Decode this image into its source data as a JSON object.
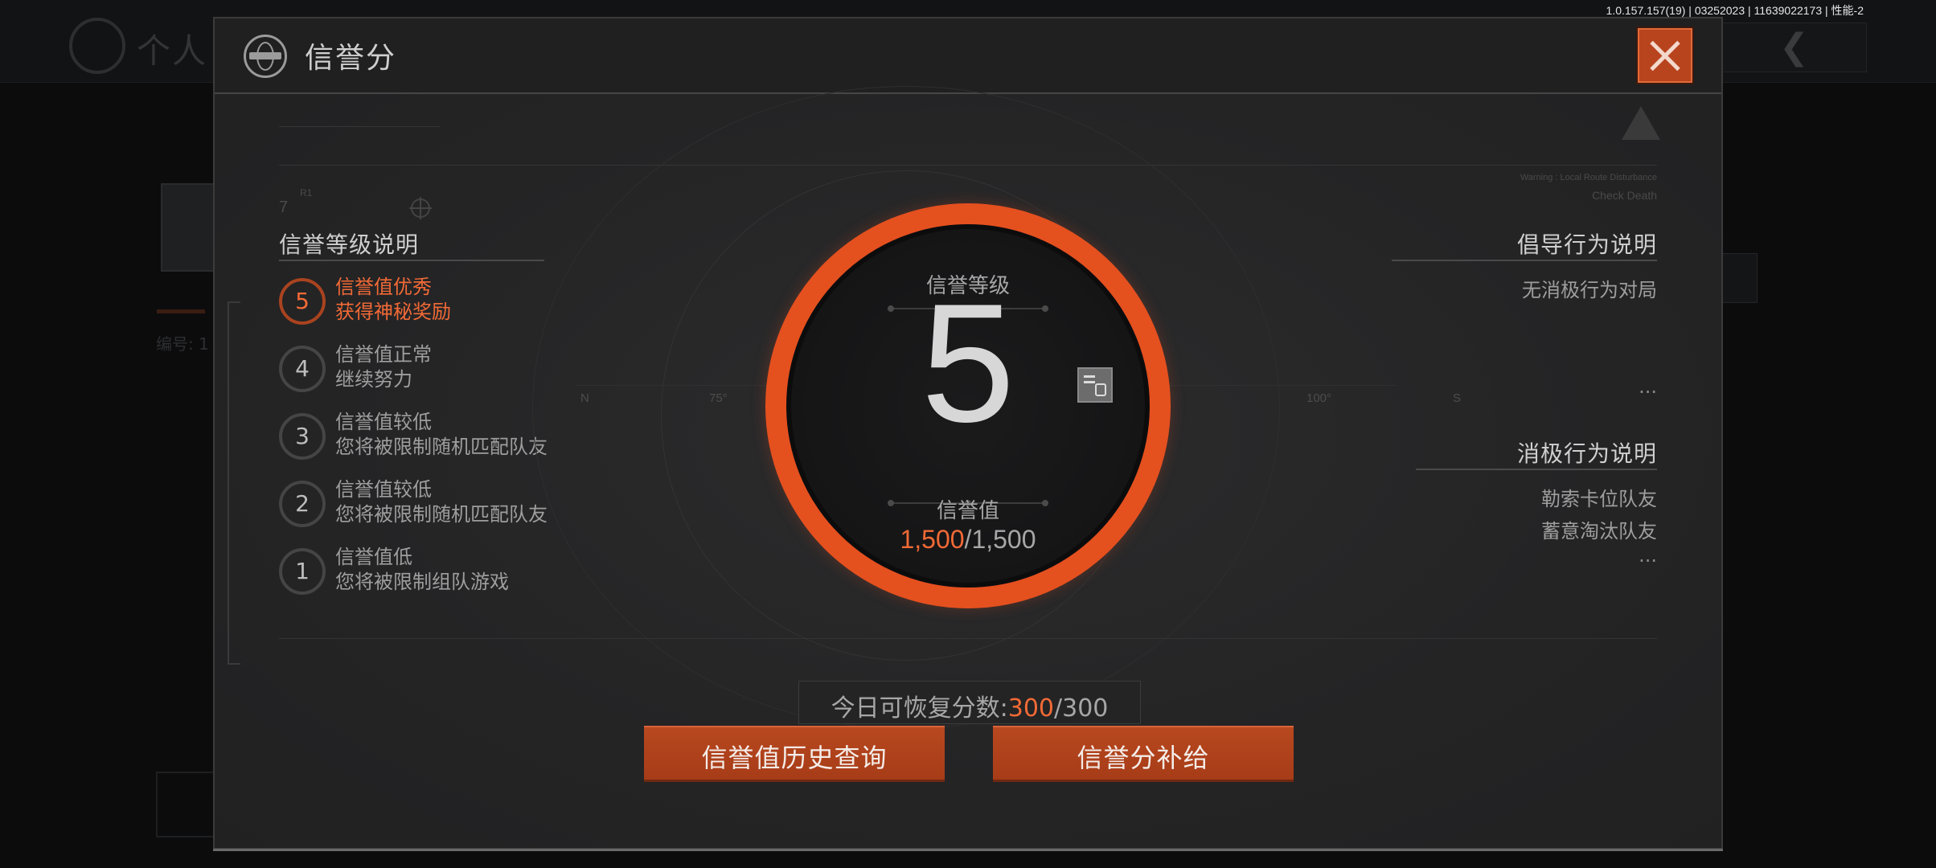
{
  "status": {
    "version": "1.0.157.157(19) | 03252023 | 11639022173 | 性能-2"
  },
  "background": {
    "page_title": "个人",
    "id_label": "编号: 1"
  },
  "dialog": {
    "title": "信誉分",
    "levels_section": {
      "title": "信誉等级说明",
      "items": [
        {
          "level": "5",
          "line1": "信誉值优秀",
          "line2": "获得神秘奖励",
          "active": true
        },
        {
          "level": "4",
          "line1": "信誉值正常",
          "line2": "继续努力",
          "active": false
        },
        {
          "level": "3",
          "line1": "信誉值较低",
          "line2": "您将被限制随机匹配队友",
          "active": false
        },
        {
          "level": "2",
          "line1": "信誉值较低",
          "line2": "您将被限制随机匹配队友",
          "active": false
        },
        {
          "level": "1",
          "line1": "信誉值低",
          "line2": "您将被限制组队游戏",
          "active": false
        }
      ]
    },
    "gauge": {
      "level_label": "信誉等级",
      "level": "5",
      "value_label": "信誉值",
      "value_current": "1,500",
      "value_max": "/1,500",
      "progress": 1.0
    },
    "compass": {
      "n": "N",
      "d75": "75°",
      "d100": "100°",
      "s": "S"
    },
    "deco": {
      "seven": "7",
      "r1": "R1",
      "warn_text": "Warning : Local Route Disturbance",
      "check_text": "Check Death"
    },
    "encouraged_section": {
      "title": "倡导行为说明",
      "items": [
        "无消极行为对局"
      ],
      "more": "..."
    },
    "negative_section": {
      "title": "消极行为说明",
      "items": [
        "勒索卡位队友",
        "蓄意淘汰队友"
      ],
      "more": "..."
    },
    "recover": {
      "label": "今日可恢复分数:",
      "current": "300",
      "max": "/300"
    },
    "buttons": {
      "history": "信誉值历史查询",
      "supplement": "信誉分补给"
    }
  },
  "colors": {
    "accent": "#e5501f",
    "accent_text": "#f26a36",
    "panel": "#262627"
  }
}
